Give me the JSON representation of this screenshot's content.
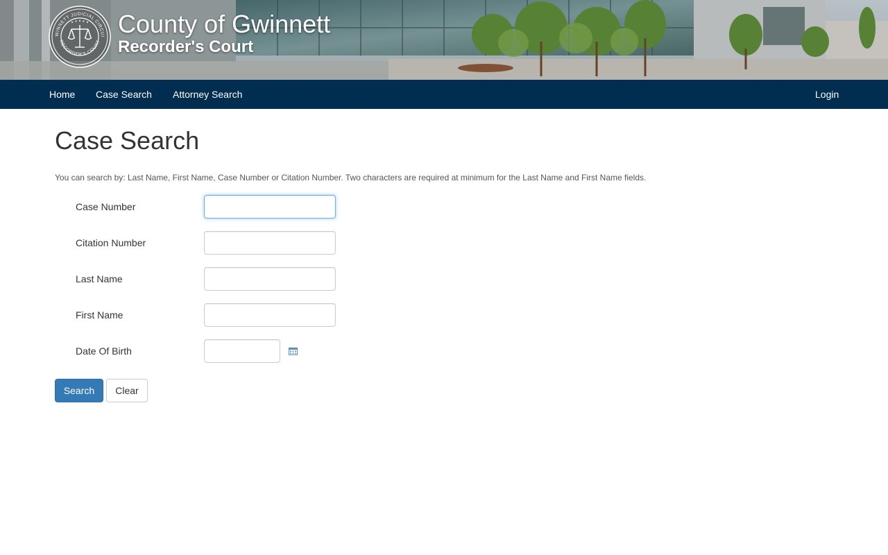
{
  "banner": {
    "title": "County of Gwinnett",
    "subtitle": "Recorder's Court",
    "seal_text_top": "GWINNETT JUDICIAL CIRCUIT",
    "seal_text_bottom": "RECORDER'S COURT"
  },
  "nav": {
    "items": [
      {
        "label": "Home"
      },
      {
        "label": "Case Search"
      },
      {
        "label": "Attorney Search"
      }
    ],
    "login_label": "Login",
    "background_color": "#002d50"
  },
  "main": {
    "title": "Case Search",
    "help_text": "You can search by: Last Name, First Name, Case Number or Citation Number. Two characters are required at minimum for the Last Name and First Name fields.",
    "fields": [
      {
        "label": "Case Number",
        "value": ""
      },
      {
        "label": "Citation Number",
        "value": ""
      },
      {
        "label": "Last Name",
        "value": ""
      },
      {
        "label": "First Name",
        "value": ""
      },
      {
        "label": "Date Of Birth",
        "value": ""
      }
    ],
    "calendar_icon": "calendar-icon",
    "buttons": {
      "search_label": "Search",
      "clear_label": "Clear"
    },
    "primary_color": "#337ab7"
  }
}
